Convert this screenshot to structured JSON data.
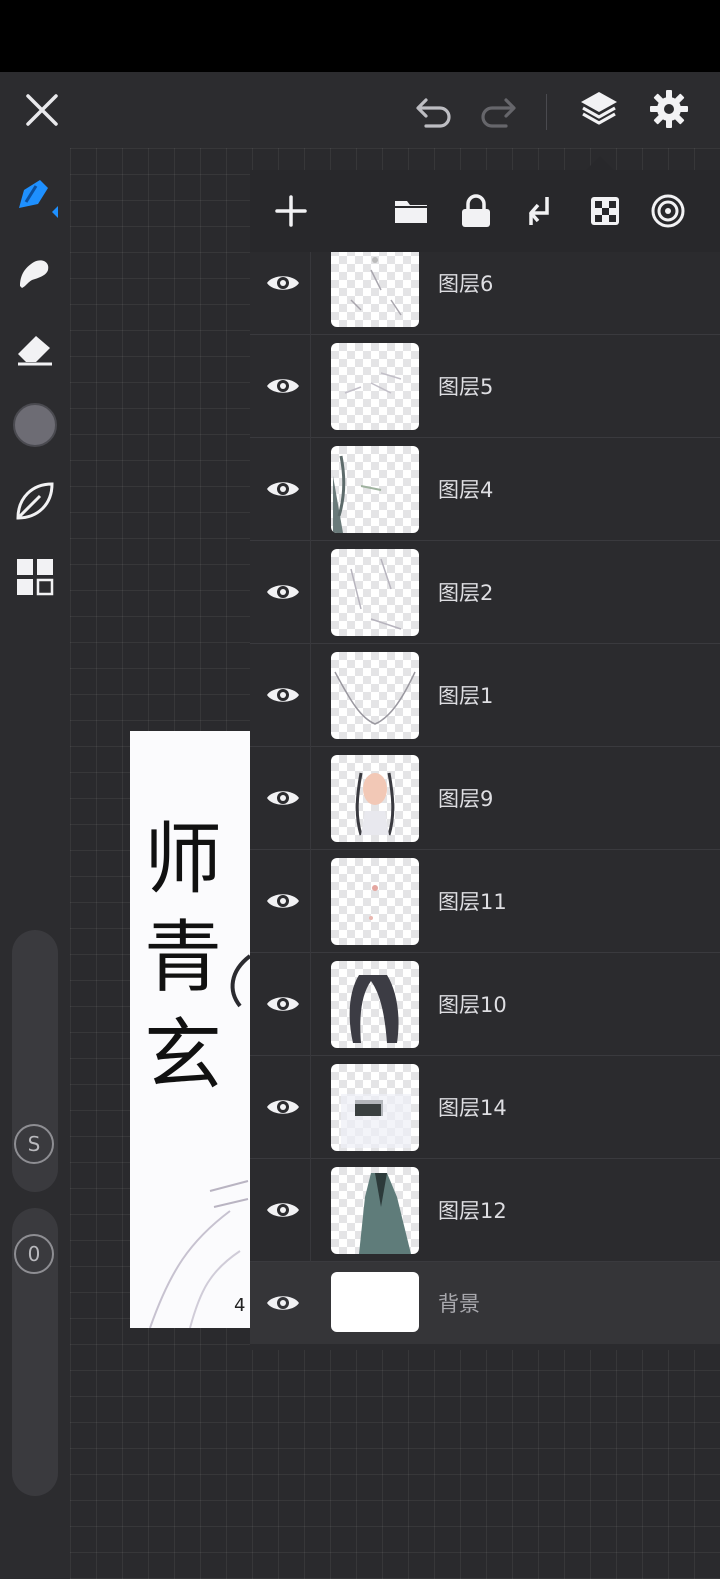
{
  "toolbar": {
    "close_icon": "close-icon",
    "undo_icon": "undo-icon",
    "redo_icon": "redo-icon",
    "layers_icon": "layers-icon",
    "settings_icon": "gear-icon"
  },
  "left_tools": [
    {
      "name": "brush",
      "icon": "brush-icon",
      "active": true
    },
    {
      "name": "smudge",
      "icon": "smudge-icon"
    },
    {
      "name": "eraser",
      "icon": "eraser-icon"
    },
    {
      "name": "color",
      "icon": "color-swatch",
      "color": "#6d6c74"
    },
    {
      "name": "stabilizer",
      "icon": "leaf-icon"
    },
    {
      "name": "gallery",
      "icon": "grid-icon"
    }
  ],
  "sliders": {
    "size_label": "S",
    "opacity_label": "0"
  },
  "artwork": {
    "text": [
      "师",
      "青",
      "玄"
    ],
    "corner_digit": "4"
  },
  "layers_panel": {
    "toolbar_icons": [
      "add-icon",
      "folder-icon",
      "lock-icon",
      "merge-down-icon",
      "checker-icon",
      "reference-icon"
    ],
    "layers": [
      {
        "name": "图层6",
        "visible": true
      },
      {
        "name": "图层5",
        "visible": true
      },
      {
        "name": "图层4",
        "visible": true
      },
      {
        "name": "图层2",
        "visible": true
      },
      {
        "name": "图层1",
        "visible": true
      },
      {
        "name": "图层9",
        "visible": true
      },
      {
        "name": "图层11",
        "visible": true
      },
      {
        "name": "图层10",
        "visible": true
      },
      {
        "name": "图层14",
        "visible": true
      },
      {
        "name": "图层12",
        "visible": true
      },
      {
        "name": "背景",
        "visible": true
      }
    ]
  },
  "colors": {
    "accent": "#1e90ff",
    "background": "#2c2c2f",
    "panel": "#2b2b2e"
  }
}
